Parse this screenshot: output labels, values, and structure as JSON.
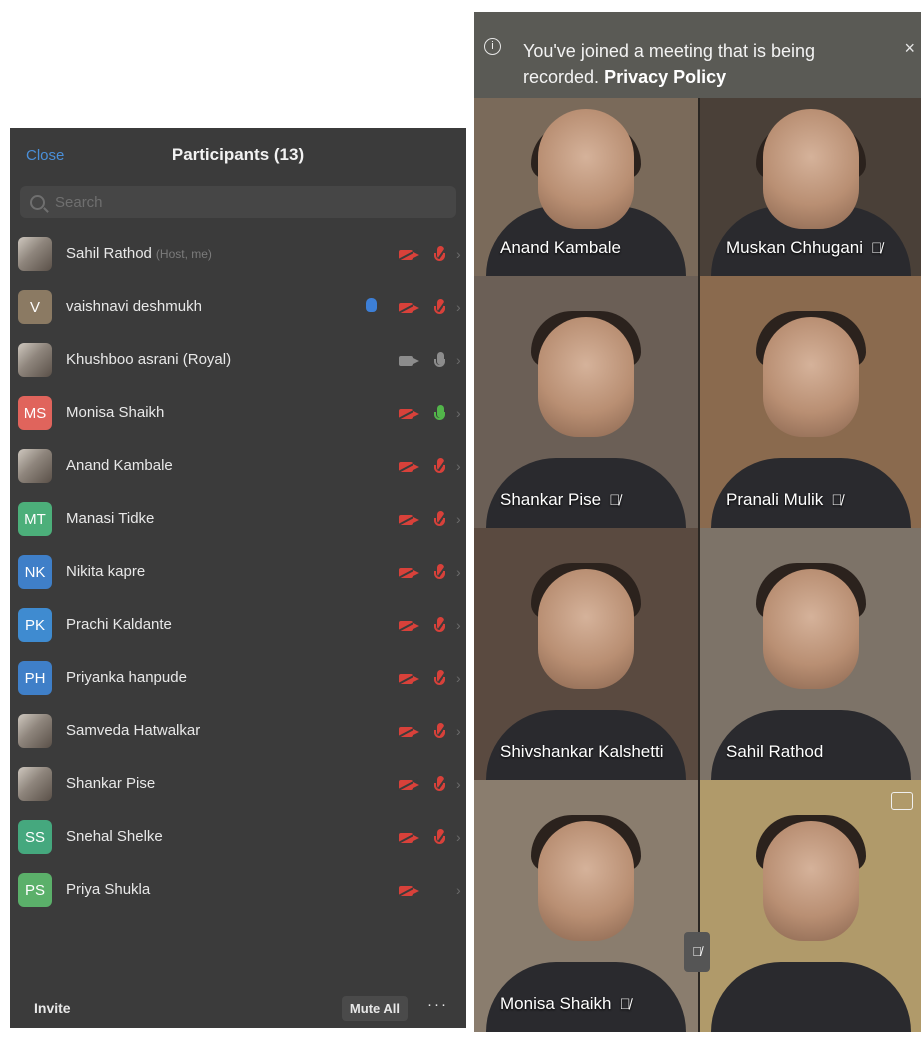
{
  "participants_panel": {
    "close_label": "Close",
    "title": "Participants (13)",
    "search_placeholder": "Search",
    "invite_label": "Invite",
    "mute_all_label": "Mute All",
    "more_label": "···",
    "participants": [
      {
        "name": "Sahil Rathod",
        "tag": "(Host, me)",
        "avatar_text": "",
        "avatar_color": "#2f2f2f",
        "photo": true,
        "video": "off",
        "mic": "muted",
        "hand": false
      },
      {
        "name": "vaishnavi deshmukh",
        "tag": "",
        "avatar_text": "V",
        "avatar_color": "#8b7a63",
        "photo": false,
        "video": "off",
        "mic": "muted",
        "hand": true
      },
      {
        "name": "Khushboo asrani (Royal)",
        "tag": "",
        "avatar_text": "",
        "avatar_color": "#e8e2da",
        "photo": true,
        "video": "on",
        "mic": "grey",
        "hand": false
      },
      {
        "name": "Monisa Shaikh",
        "tag": "",
        "avatar_text": "MS",
        "avatar_color": "#e0645c",
        "photo": false,
        "video": "off",
        "mic": "green",
        "hand": false
      },
      {
        "name": "Anand Kambale",
        "tag": "",
        "avatar_text": "",
        "avatar_color": "#6e8aa0",
        "photo": true,
        "video": "off",
        "mic": "muted",
        "hand": false
      },
      {
        "name": "Manasi Tidke",
        "tag": "",
        "avatar_text": "MT",
        "avatar_color": "#4caf7a",
        "photo": false,
        "video": "off",
        "mic": "muted",
        "hand": false
      },
      {
        "name": "Nikita kapre",
        "tag": "",
        "avatar_text": "NK",
        "avatar_color": "#3f7fc8",
        "photo": false,
        "video": "off",
        "mic": "muted",
        "hand": false
      },
      {
        "name": "Prachi Kaldante",
        "tag": "",
        "avatar_text": "PK",
        "avatar_color": "#3f8bd0",
        "photo": false,
        "video": "off",
        "mic": "muted",
        "hand": false
      },
      {
        "name": "Priyanka hanpude",
        "tag": "",
        "avatar_text": "PH",
        "avatar_color": "#3f7fc8",
        "photo": false,
        "video": "off",
        "mic": "muted",
        "hand": false
      },
      {
        "name": "Samveda Hatwalkar",
        "tag": "",
        "avatar_text": "",
        "avatar_color": "#8d7d6c",
        "photo": true,
        "video": "off",
        "mic": "muted",
        "hand": false
      },
      {
        "name": "Shankar Pise",
        "tag": "",
        "avatar_text": "",
        "avatar_color": "#5c7a5a",
        "photo": true,
        "video": "off",
        "mic": "muted",
        "hand": false
      },
      {
        "name": "Snehal Shelke",
        "tag": "",
        "avatar_text": "SS",
        "avatar_color": "#45a87e",
        "photo": false,
        "video": "off",
        "mic": "muted",
        "hand": false
      },
      {
        "name": "Priya Shukla",
        "tag": "",
        "avatar_text": "PS",
        "avatar_color": "#5bb06a",
        "photo": false,
        "video": "off",
        "mic": "none",
        "hand": false
      }
    ]
  },
  "meeting": {
    "banner_text": "You've joined a meeting that is being recorded.",
    "banner_link": "Privacy Policy",
    "banner_close": "×",
    "info_icon": "i",
    "tiles": [
      {
        "name": "Anand Kambale",
        "muted": false,
        "bg": "#7a6a5a"
      },
      {
        "name": "Muskan Chhugani",
        "muted": true,
        "bg": "#4a4038"
      },
      {
        "name": "Shankar Pise",
        "muted": true,
        "bg": "#6b5f56"
      },
      {
        "name": "Pranali Mulik",
        "muted": true,
        "bg": "#8a6a4e"
      },
      {
        "name": "Shivshankar Kalshetti",
        "muted": false,
        "bg": "#5a4a40"
      },
      {
        "name": "Sahil Rathod",
        "muted": false,
        "bg": "#7d7368"
      },
      {
        "name": "Monisa Shaikh",
        "muted": true,
        "bg": "#8a7d6e"
      },
      {
        "name": "",
        "muted": false,
        "bg": "#b09a6a"
      }
    ],
    "mute_glyph": "🎙̸"
  }
}
